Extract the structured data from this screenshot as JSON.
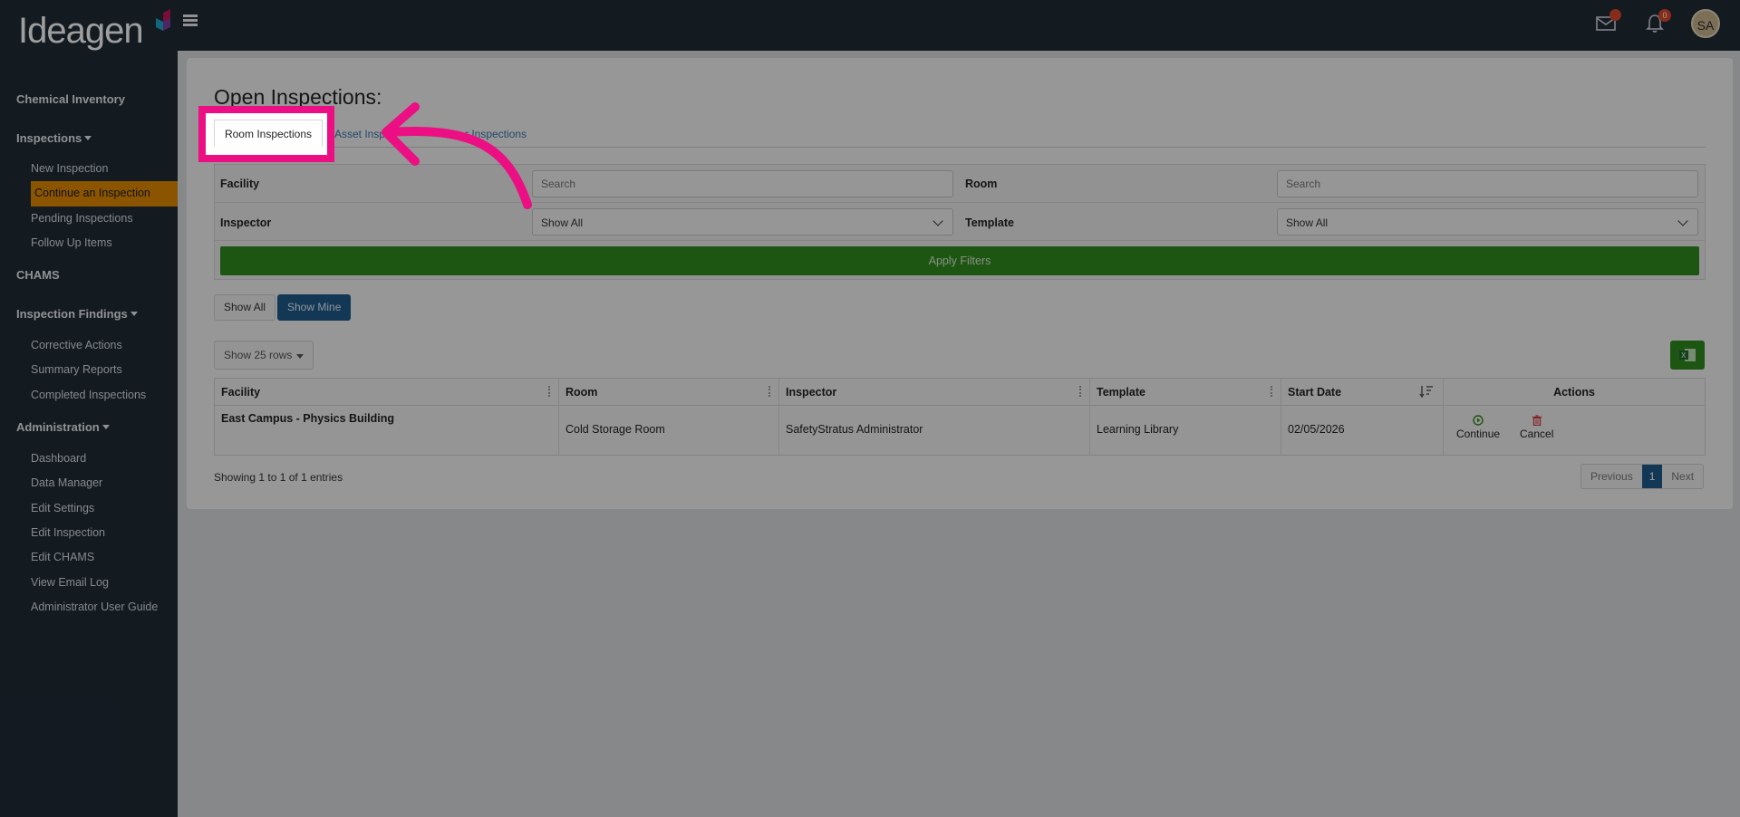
{
  "brand": {
    "logo": "Ideagen"
  },
  "header": {
    "notification_count": "0",
    "user_initials": "SA"
  },
  "sidebar": {
    "chemical_inventory": "Chemical Inventory",
    "inspections": "Inspections",
    "inspection_items": [
      "New Inspection",
      "Continue an Inspection",
      "Pending Inspections",
      "Follow Up Items"
    ],
    "chams": "CHAMS",
    "inspection_findings": "Inspection Findings",
    "findings_items": [
      "Corrective Actions",
      "Summary Reports",
      "Completed Inspections"
    ],
    "administration": "Administration",
    "admin_items": [
      "Dashboard",
      "Data Manager",
      "Edit Settings",
      "Edit Inspection",
      "Edit CHAMS",
      "View Email Log",
      "Administrator User Guide"
    ]
  },
  "page": {
    "title": "Open Inspections:"
  },
  "tabs": {
    "room": "Room Inspections",
    "asset": "Asset Insp",
    "other": "r Inspections"
  },
  "filters": {
    "facility_label": "Facility",
    "facility_placeholder": "Search",
    "room_label": "Room",
    "room_placeholder": "Search",
    "inspector_label": "Inspector",
    "inspector_value": "Show All",
    "template_label": "Template",
    "template_value": "Show All",
    "apply_label": "Apply Filters"
  },
  "toggles": {
    "show_all": "Show All",
    "show_mine": "Show Mine"
  },
  "table_controls": {
    "rows_label": "Show 25 rows"
  },
  "table": {
    "columns": [
      "Facility",
      "Room",
      "Inspector",
      "Template",
      "Start Date",
      "Actions"
    ],
    "rows": [
      {
        "facility": "East Campus - Physics Building",
        "room": "Cold Storage Room",
        "inspector": "SafetyStratus Administrator",
        "template": "Learning Library",
        "start_date": "02/05/2026",
        "continue_label": "Continue",
        "cancel_label": "Cancel"
      }
    ]
  },
  "footer": {
    "showing": "Showing 1 to 1 of 1 entries",
    "previous": "Previous",
    "page": "1",
    "next": "Next"
  },
  "colors": {
    "accent_pink": "#ec0f83",
    "active_nav": "#e08a00",
    "primary_blue": "#1f5b8c",
    "success_green": "#2f8c1e"
  }
}
